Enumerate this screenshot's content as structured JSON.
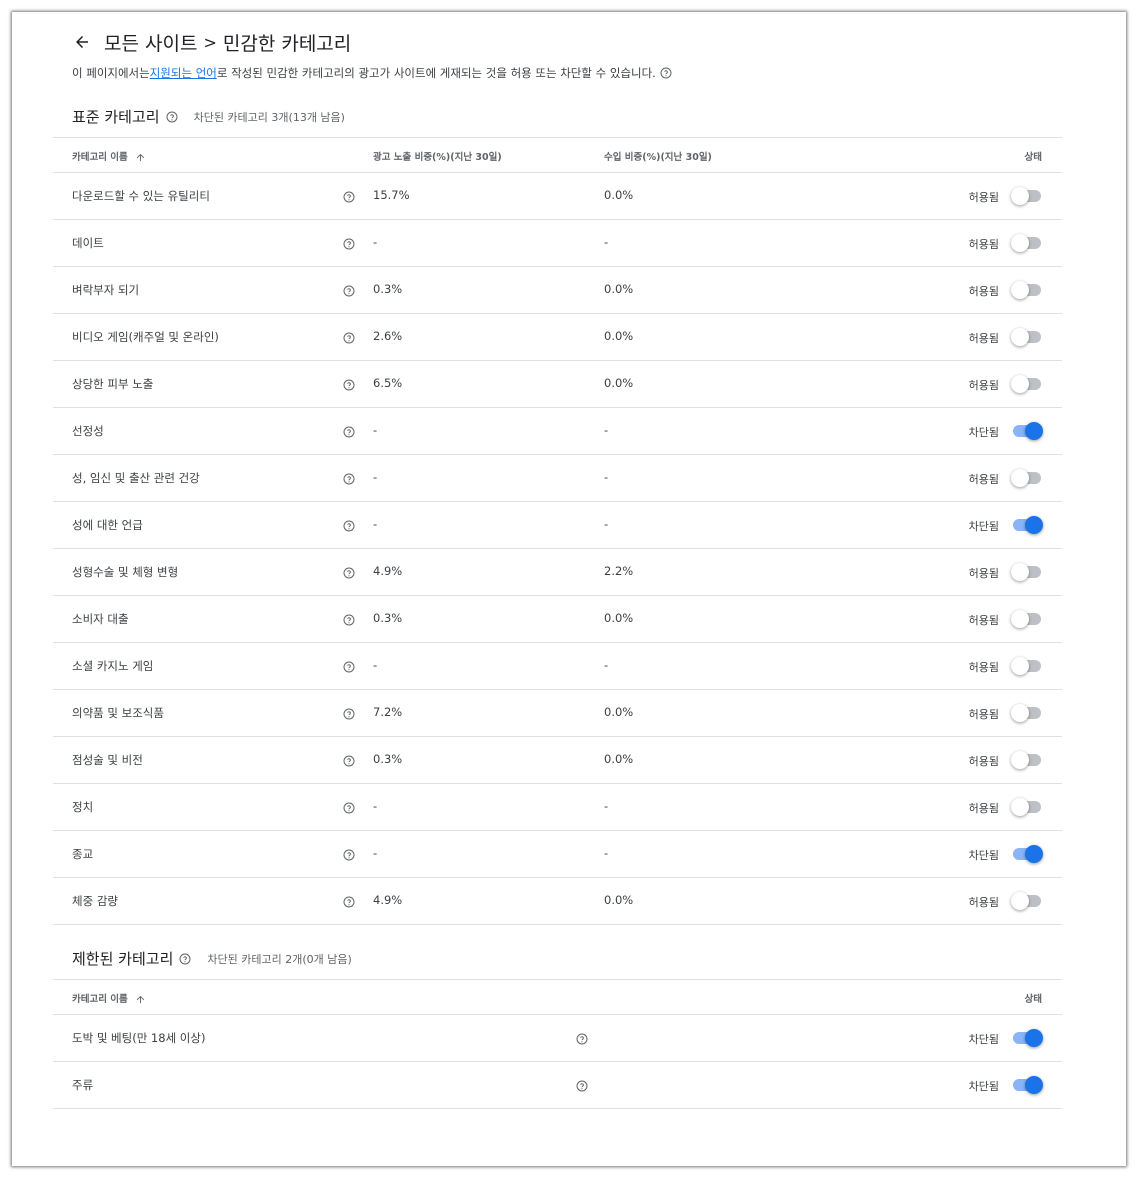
{
  "header": {
    "breadcrumb_parent": "모든 사이트",
    "separator": ">",
    "breadcrumb_current": "민감한 카테고리"
  },
  "description": {
    "before_link": "이 페이지에서는 ",
    "link": "지원되는 언어",
    "after_link": "로 작성된 민감한 카테고리의 광고가 사이트에 게재되는 것을 허용 또는 차단할 수 있습니다."
  },
  "standard": {
    "title": "표준 카테고리",
    "note": "차단된 카테고리 3개(13개 남음)",
    "columns": {
      "name": "카테고리 이름",
      "impressions": "광고 노출 비중(%)(지난 30일)",
      "earnings": "수입 비중(%)(지난 30일)",
      "status": "상태"
    },
    "rows": [
      {
        "name": "다운로드할 수 있는 유틸리티",
        "impressions": "15.7%",
        "earnings": "0.0%",
        "status": "허용됨",
        "on": false
      },
      {
        "name": "데이트",
        "impressions": "-",
        "earnings": "-",
        "status": "허용됨",
        "on": false
      },
      {
        "name": "벼락부자 되기",
        "impressions": "0.3%",
        "earnings": "0.0%",
        "status": "허용됨",
        "on": false
      },
      {
        "name": "비디오 게임(캐주얼 및 온라인)",
        "impressions": "2.6%",
        "earnings": "0.0%",
        "status": "허용됨",
        "on": false
      },
      {
        "name": "상당한 피부 노출",
        "impressions": "6.5%",
        "earnings": "0.0%",
        "status": "허용됨",
        "on": false
      },
      {
        "name": "선정성",
        "impressions": "-",
        "earnings": "-",
        "status": "차단됨",
        "on": true
      },
      {
        "name": "성, 임신 및 출산 관련 건강",
        "impressions": "-",
        "earnings": "-",
        "status": "허용됨",
        "on": false
      },
      {
        "name": "성에 대한 언급",
        "impressions": "-",
        "earnings": "-",
        "status": "차단됨",
        "on": true
      },
      {
        "name": "성형수술 및 체형 변형",
        "impressions": "4.9%",
        "earnings": "2.2%",
        "status": "허용됨",
        "on": false
      },
      {
        "name": "소비자 대출",
        "impressions": "0.3%",
        "earnings": "0.0%",
        "status": "허용됨",
        "on": false
      },
      {
        "name": "소셜 카지노 게임",
        "impressions": "-",
        "earnings": "-",
        "status": "허용됨",
        "on": false
      },
      {
        "name": "의약품 및 보조식품",
        "impressions": "7.2%",
        "earnings": "0.0%",
        "status": "허용됨",
        "on": false
      },
      {
        "name": "점성술 및 비전",
        "impressions": "0.3%",
        "earnings": "0.0%",
        "status": "허용됨",
        "on": false
      },
      {
        "name": "정치",
        "impressions": "-",
        "earnings": "-",
        "status": "허용됨",
        "on": false
      },
      {
        "name": "종교",
        "impressions": "-",
        "earnings": "-",
        "status": "차단됨",
        "on": true
      },
      {
        "name": "체중 감량",
        "impressions": "4.9%",
        "earnings": "0.0%",
        "status": "허용됨",
        "on": false
      }
    ]
  },
  "restricted": {
    "title": "제한된 카테고리",
    "note": "차단된 카테고리 2개(0개 남음)",
    "columns": {
      "name": "카테고리 이름",
      "status": "상태"
    },
    "rows": [
      {
        "name": "도박 및 베팅(만 18세 이상)",
        "status": "차단됨",
        "on": true
      },
      {
        "name": "주류",
        "status": "차단됨",
        "on": true
      }
    ]
  },
  "colors": {
    "accent": "#1a73e8",
    "toggle_on_track": "#8ab4f8",
    "toggle_off_track": "#bdc1c6"
  }
}
